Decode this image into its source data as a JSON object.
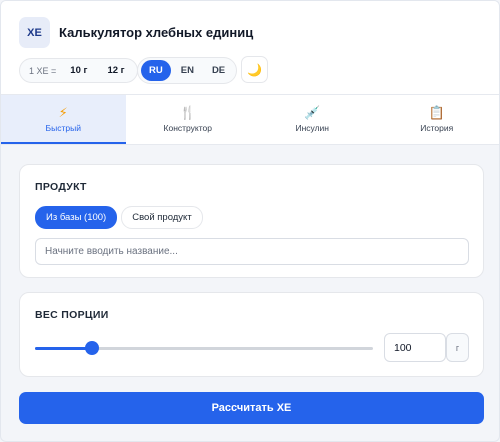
{
  "header": {
    "logo_text": "ХЕ",
    "title": "Калькулятор хлебных единиц"
  },
  "unit_selector": {
    "prefix": "1 ХЕ =",
    "options": [
      "10 г",
      "12 г"
    ]
  },
  "language": {
    "options": [
      "RU",
      "EN",
      "DE"
    ],
    "selected": "RU"
  },
  "theme_toggle": {
    "icon": "moon-icon",
    "glyph": "🌙"
  },
  "tabs": [
    {
      "label": "Быстрый",
      "icon": "lightning-icon",
      "glyph": "⚡",
      "active": true
    },
    {
      "label": "Конструктор",
      "icon": "cutlery-icon",
      "glyph": "🍴",
      "active": false
    },
    {
      "label": "Инсулин",
      "icon": "syringe-icon",
      "glyph": "💉",
      "active": false
    },
    {
      "label": "История",
      "icon": "clipboard-icon",
      "glyph": "📋",
      "active": false
    }
  ],
  "product": {
    "title": "ПРОДУКТ",
    "from_db_label": "Из базы (100)",
    "own_product_label": "Свой продукт",
    "search_placeholder": "Начните вводить название..."
  },
  "portion": {
    "title": "ВЕС ПОРЦИИ",
    "value": "100",
    "unit": "г",
    "slider_fraction": 0.17
  },
  "calculate_label": "Рассчитать ХЕ",
  "colors": {
    "accent": "#2563eb",
    "active_tab_bg": "#e8eefb",
    "background": "#f3f5f9"
  }
}
